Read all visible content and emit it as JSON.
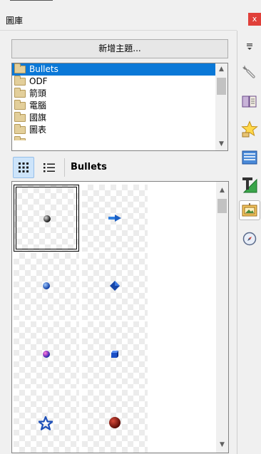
{
  "panel": {
    "title": "圖庫",
    "close_label": "x"
  },
  "toolbar": {
    "new_theme_label": "新增主題..."
  },
  "theme_list": {
    "items": [
      {
        "label": "Bullets",
        "selected": true
      },
      {
        "label": "ODF",
        "selected": false
      },
      {
        "label": "箭頭",
        "selected": false
      },
      {
        "label": "電腦",
        "selected": false
      },
      {
        "label": "國旗",
        "selected": false
      },
      {
        "label": "圖表",
        "selected": false
      }
    ]
  },
  "view": {
    "mode": "icon-view",
    "current_theme": "Bullets"
  },
  "gallery": {
    "items": [
      {
        "name": "bullet-gray-sphere",
        "selected": true
      },
      {
        "name": "bullet-blue-arrow",
        "selected": false
      },
      {
        "name": "bullet-blue-sphere",
        "selected": false
      },
      {
        "name": "bullet-blue-diamond",
        "selected": false
      },
      {
        "name": "bullet-pink-sphere",
        "selected": false
      },
      {
        "name": "bullet-blue-cube",
        "selected": false
      },
      {
        "name": "bullet-blue-star",
        "selected": false
      },
      {
        "name": "bullet-red-sphere",
        "selected": false
      }
    ]
  },
  "sidebar": {
    "items": [
      {
        "name": "menu-icon",
        "active": false
      },
      {
        "name": "properties-wrench-icon",
        "active": false
      },
      {
        "name": "styles-icon",
        "active": false
      },
      {
        "name": "gallery-star-icon",
        "active": false
      },
      {
        "name": "navigator-icon",
        "active": false
      },
      {
        "name": "page-icon",
        "active": false
      },
      {
        "name": "gallery-picture-icon",
        "active": true
      },
      {
        "name": "navigator-compass-icon",
        "active": false
      }
    ]
  },
  "colors": {
    "selection": "#0a78d7",
    "close": "#e0403a",
    "view_active": "#cde4fa"
  }
}
